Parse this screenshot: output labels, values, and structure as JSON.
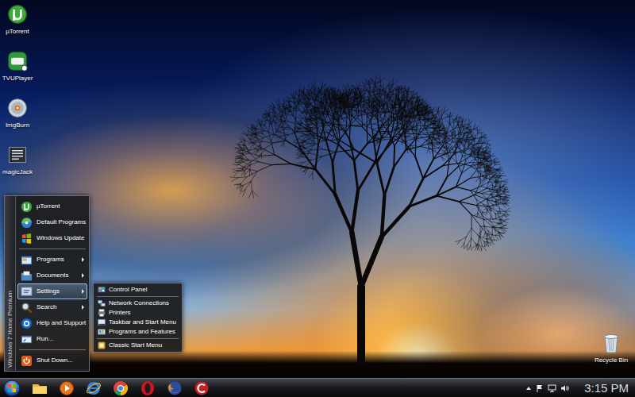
{
  "desktop": {
    "icons": [
      {
        "label": "µTorrent"
      },
      {
        "label": "TVUPlayer"
      },
      {
        "label": "ImgBurn"
      },
      {
        "label": "magicJack"
      }
    ],
    "recycle_bin": {
      "label": "Recycle Bin"
    }
  },
  "start_menu": {
    "banner": "Windows 7 Home Premium",
    "items": [
      {
        "kind": "item",
        "label": "µTorrent",
        "has_submenu": false,
        "selected": false
      },
      {
        "kind": "item",
        "label": "Default Programs",
        "has_submenu": false,
        "selected": false
      },
      {
        "kind": "item",
        "label": "Windows Update",
        "has_submenu": false,
        "selected": false
      },
      {
        "kind": "separator"
      },
      {
        "kind": "item",
        "label": "Programs",
        "has_submenu": true,
        "selected": false
      },
      {
        "kind": "item",
        "label": "Documents",
        "has_submenu": true,
        "selected": false
      },
      {
        "kind": "item",
        "label": "Settings",
        "has_submenu": true,
        "selected": true
      },
      {
        "kind": "item",
        "label": "Search",
        "has_submenu": true,
        "selected": false
      },
      {
        "kind": "item",
        "label": "Help and Support",
        "has_submenu": false,
        "selected": false
      },
      {
        "kind": "item",
        "label": "Run...",
        "has_submenu": false,
        "selected": false
      },
      {
        "kind": "separator"
      },
      {
        "kind": "item",
        "label": "Shut Down...",
        "has_submenu": false,
        "selected": false
      }
    ]
  },
  "submenu": {
    "items": [
      {
        "kind": "item",
        "label": "Control Panel",
        "selected": false
      },
      {
        "kind": "separator"
      },
      {
        "kind": "item",
        "label": "Network Connections",
        "selected": false
      },
      {
        "kind": "item",
        "label": "Printers",
        "selected": false
      },
      {
        "kind": "item",
        "label": "Taskbar and Start Menu",
        "selected": false
      },
      {
        "kind": "item",
        "label": "Programs and Features",
        "selected": false
      },
      {
        "kind": "separator"
      },
      {
        "kind": "item",
        "label": "Classic Start Menu",
        "selected": false
      }
    ]
  },
  "taskbar": {
    "clock": "3:15 PM"
  }
}
